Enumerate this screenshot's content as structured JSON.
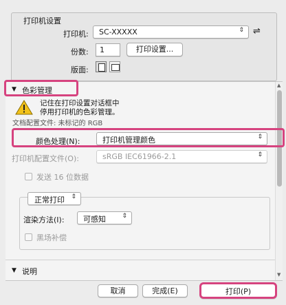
{
  "printer_settings": {
    "group_title": "打印机设置",
    "printer_label": "打印机:",
    "printer_value": "SC-XXXXX",
    "copies_label": "份数:",
    "copies_value": "1",
    "print_settings_button": "打印设置...",
    "layout_label": "版面:"
  },
  "color_mgmt": {
    "section_title": "色彩管理",
    "warning_line1": "记住在打印设置对话框中",
    "warning_line2": "停用打印机的色彩管理。",
    "doc_profile": "文档配置文件: 未标记的 RGB",
    "color_handling_label": "颜色处理(N):",
    "color_handling_value": "打印机管理颜色",
    "printer_profile_label": "打印机配置文件(O):",
    "printer_profile_value": "sRGB IEC61966-2.1",
    "send16_label": "发送 16 位数据",
    "intent_mode_value": "正常打印",
    "rendering_label": "渲染方法(I):",
    "rendering_value": "可感知",
    "bpc_label": "黑场补偿"
  },
  "description": {
    "section_title": "说明"
  },
  "buttons": {
    "cancel": "取消",
    "done": "完成(E)",
    "print": "打印(P)"
  },
  "colors": {
    "highlight": "#d6437f",
    "warning_yellow": "#f2c21a"
  }
}
